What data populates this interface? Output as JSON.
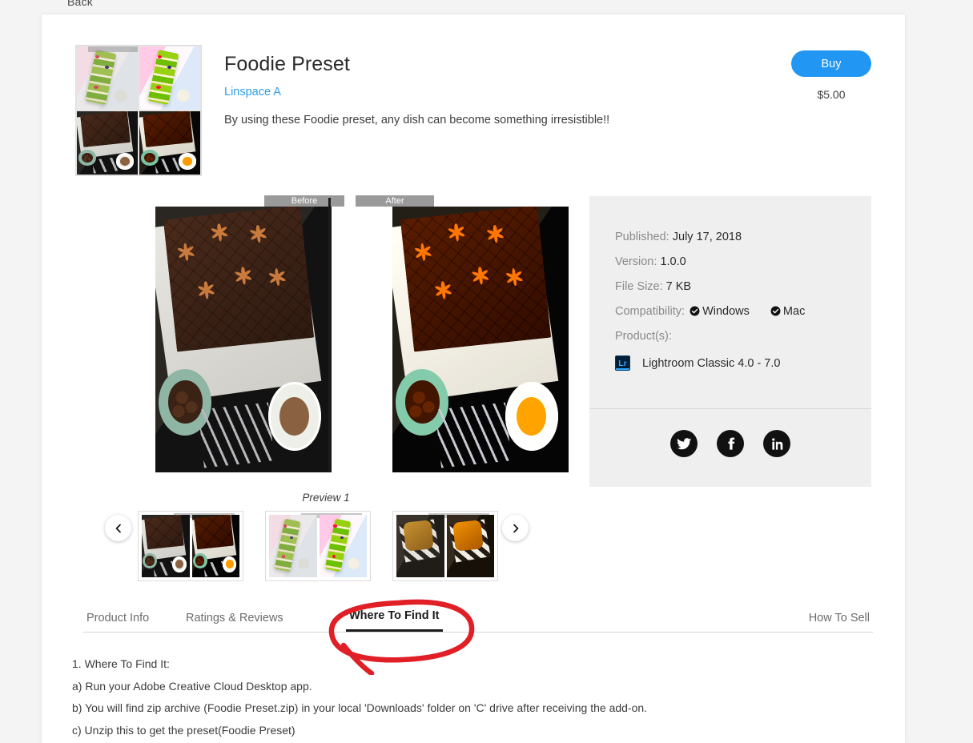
{
  "nav": {
    "back_label": "Back"
  },
  "product": {
    "title": "Foodie Preset",
    "author": "Linspace A",
    "description": "By using these Foodie preset, any dish can become something irresistible!!",
    "buy_label": "Buy",
    "price": "$5.00"
  },
  "preview": {
    "before_label": "Before",
    "after_label": "After",
    "caption": "Preview 1",
    "prev_icon": "chevron-left-icon",
    "next_icon": "chevron-right-icon"
  },
  "info": {
    "published_label": "Published:",
    "published_value": "July 17, 2018",
    "version_label": "Version:",
    "version_value": "1.0.0",
    "filesize_label": "File Size:",
    "filesize_value": "7 KB",
    "compatibility_label": "Compatibility:",
    "compat_windows": "Windows",
    "compat_mac": "Mac",
    "products_label": "Product(s):",
    "product_icon": "lightroom-icon",
    "product_name": "Lightroom Classic 4.0 - 7.0",
    "socials": [
      {
        "name": "twitter-icon"
      },
      {
        "name": "facebook-icon"
      },
      {
        "name": "linkedin-icon"
      }
    ]
  },
  "tabs": {
    "items": [
      {
        "label": "Product Info",
        "active": false
      },
      {
        "label": "Ratings & Reviews",
        "active": false
      },
      {
        "label": "Where To Find It",
        "active": true
      }
    ],
    "how_to_sell": "How To Sell"
  },
  "body": {
    "lines": [
      "1. Where To Find It:",
      "a) Run your Adobe Creative Cloud Desktop app.",
      "b) You will find zip archive (Foodie Preset.zip) in your local 'Downloads' folder on 'C' drive after receiving the add-on.",
      "c) Unzip this to get the preset(Foodie Preset)"
    ]
  },
  "colors": {
    "accent": "#2196f3",
    "link": "#2d9fe0",
    "panel": "#efefef",
    "annotation": "#e01f26"
  }
}
